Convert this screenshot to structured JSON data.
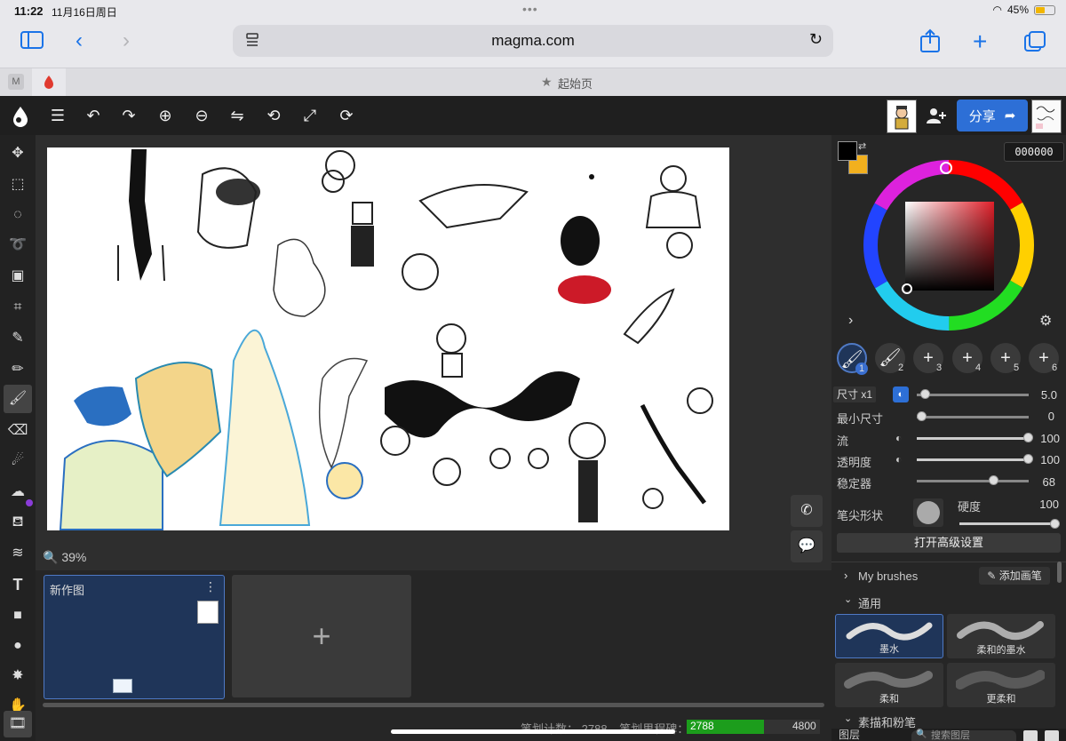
{
  "status": {
    "time": "11:22",
    "date": "11月16日周日",
    "battery": "45%"
  },
  "browser": {
    "url": "magma.com",
    "tab_title": "起始页",
    "tab_badge": "M"
  },
  "app": {
    "share_label": "分享",
    "zoom": "39%"
  },
  "color": {
    "hex": "000000",
    "primary": "#000000",
    "secondary": "#f2b01e"
  },
  "brush_slots": [
    "1",
    "2",
    "3",
    "4",
    "5",
    "6"
  ],
  "brush_settings": {
    "size_label": "尺寸 x1",
    "size_value": "5.0",
    "min_size_label": "最小尺寸",
    "min_size_value": "0",
    "flow_label": "流",
    "flow_value": "100",
    "opacity_label": "透明度",
    "opacity_value": "100",
    "stabilizer_label": "稳定器",
    "stabilizer_value": "68",
    "tip_shape_label": "笔尖形状",
    "hardness_label": "硬度",
    "hardness_value": "100",
    "advanced_button": "打开高级设置"
  },
  "brush_library": {
    "my_brushes": "My brushes",
    "add_brush": "添加画笔",
    "section_general": "通用",
    "brushes": [
      "墨水",
      "柔和的墨水",
      "柔和",
      "更柔和"
    ],
    "section_sketch": "素描和粉笔",
    "layers_label": "图层",
    "search_layers_placeholder": "搜索图层"
  },
  "frames": {
    "frame_title": "新作图",
    "add": "+"
  },
  "stats": {
    "stroke_count_label": "笔划计数：",
    "stroke_count": "2788",
    "ink_label": "笔划里程碑：",
    "ink_current": "2788",
    "ink_target": "4800",
    "ink_progress": 0.58
  }
}
